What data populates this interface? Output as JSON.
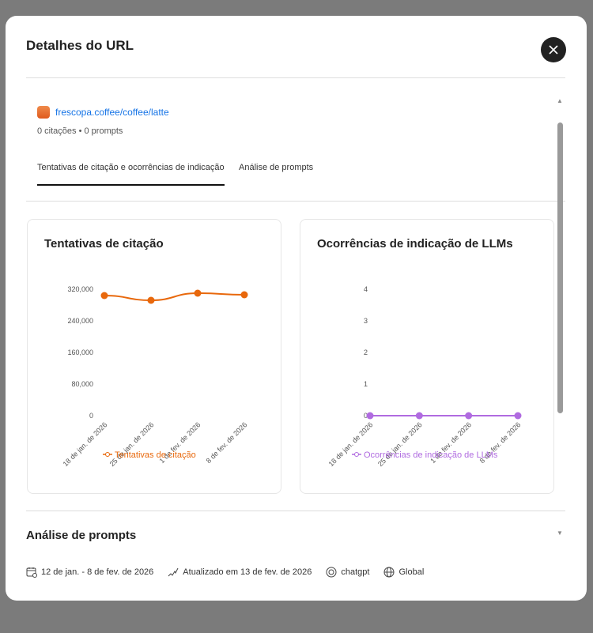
{
  "modal": {
    "title": "Detalhes do URL",
    "close_icon": "close-icon"
  },
  "url": {
    "link": "frescopa.coffee/coffee/latte",
    "meta": "0 citações • 0 prompts"
  },
  "tabs": [
    {
      "label": "Tentativas de citação e ocorrências de indicação",
      "active": true
    },
    {
      "label": "Análise de prompts",
      "active": false
    }
  ],
  "section_title": "Análise de prompts",
  "footer": {
    "date_range": "12 de jan. - 8 de fev. de 2026",
    "updated": "Atualizado em 13 de fev. de 2026",
    "model": "chatgpt",
    "region": "Global"
  },
  "chart_data": [
    {
      "type": "line",
      "title": "Tentativas de citação",
      "categories": [
        "18 de jan. de 2026",
        "25 de jan. de 2026",
        "1 de fev. de 2026",
        "8 de fev. de 2026"
      ],
      "series": [
        {
          "name": "Tentativas de citação",
          "values": [
            304000,
            292000,
            310000,
            306000
          ],
          "color": "#e8680c"
        }
      ],
      "yticks": [
        "0",
        "80,000",
        "160,000",
        "240,000",
        "320,000"
      ],
      "ylim": [
        0,
        320000
      ]
    },
    {
      "type": "line",
      "title": "Ocorrências de indicação de LLMs",
      "categories": [
        "18 de jan. de 2026",
        "25 de jan. de 2026",
        "1 de fev. de 2026",
        "8 de fev. de 2026"
      ],
      "series": [
        {
          "name": "Ocorrências de indicação de LLMs",
          "values": [
            0,
            0,
            0,
            0
          ],
          "color": "#b06be0"
        }
      ],
      "yticks": [
        "0",
        "1",
        "2",
        "3",
        "4"
      ],
      "ylim": [
        0,
        4
      ]
    }
  ]
}
